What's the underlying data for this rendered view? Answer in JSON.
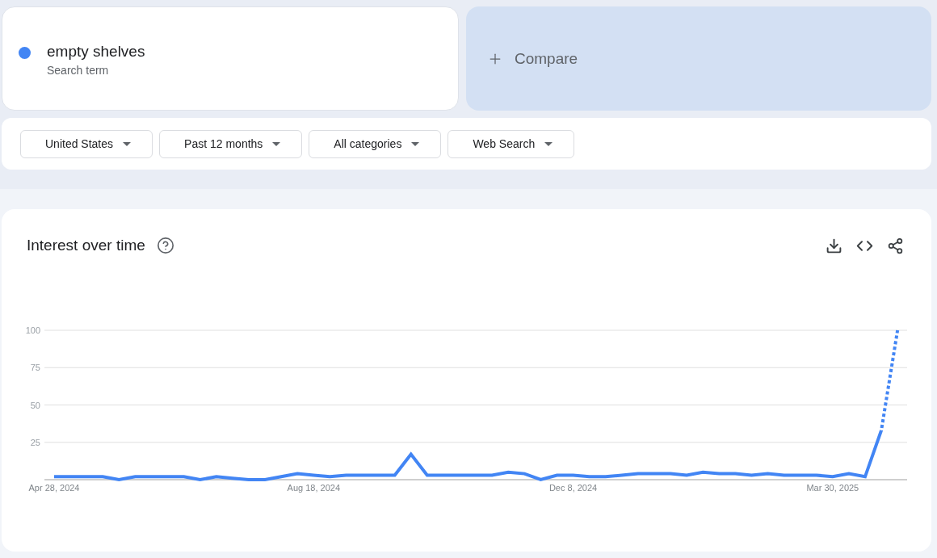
{
  "search_term": {
    "label": "empty shelves",
    "sublabel": "Search term",
    "color": "#4285f4"
  },
  "compare": {
    "label": "Compare"
  },
  "filters": [
    {
      "label": "United States"
    },
    {
      "label": "Past 12 months"
    },
    {
      "label": "All categories"
    },
    {
      "label": "Web Search"
    }
  ],
  "interest_over_time": {
    "title": "Interest over time",
    "chart_data": {
      "type": "line",
      "ylim": [
        0,
        100
      ],
      "yticks": [
        25,
        50,
        75,
        100
      ],
      "grid": true,
      "categories": [
        "Apr 28, 2024",
        null,
        null,
        null,
        null,
        null,
        null,
        null,
        null,
        null,
        null,
        null,
        null,
        null,
        null,
        null,
        "Aug 18, 2024",
        null,
        null,
        null,
        null,
        null,
        null,
        null,
        null,
        null,
        null,
        null,
        null,
        null,
        null,
        null,
        "Dec 8, 2024",
        null,
        null,
        null,
        null,
        null,
        null,
        null,
        null,
        null,
        null,
        null,
        null,
        null,
        null,
        null,
        "Mar 30, 2025",
        null,
        null,
        null,
        null
      ],
      "series": [
        {
          "color": "#4285f4",
          "line_style": "solid_then_dotted",
          "values": [
            2,
            2,
            2,
            2,
            0,
            2,
            2,
            2,
            2,
            0,
            2,
            1,
            0,
            0,
            2,
            4,
            3,
            2,
            3,
            3,
            3,
            3,
            17,
            3,
            3,
            3,
            3,
            3,
            5,
            4,
            0,
            3,
            3,
            2,
            2,
            3,
            4,
            4,
            4,
            3,
            5,
            4,
            4,
            3,
            4,
            3,
            3,
            3,
            2,
            4,
            2,
            33,
            100
          ]
        }
      ]
    }
  }
}
